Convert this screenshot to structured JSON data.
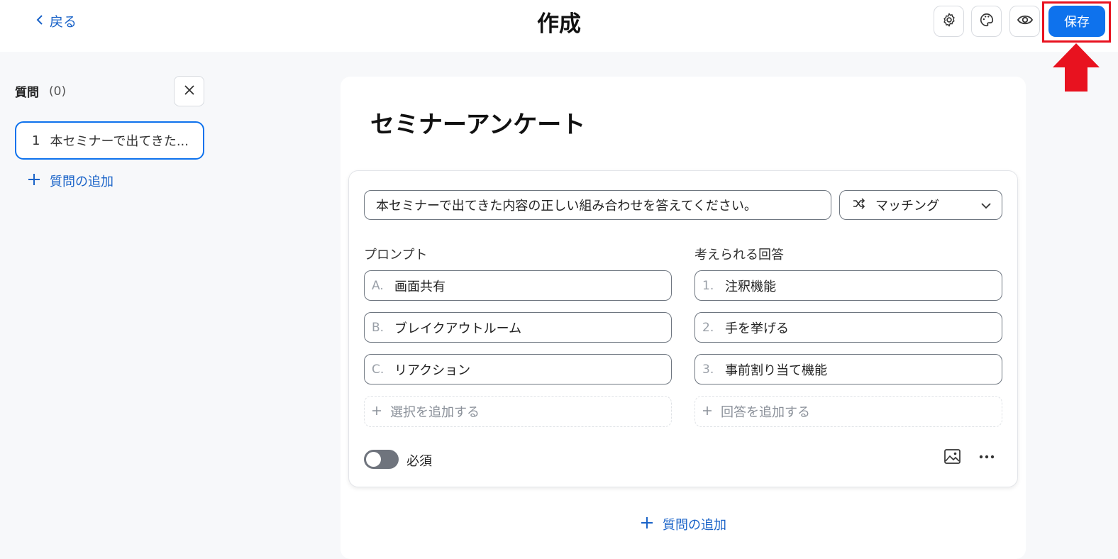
{
  "header": {
    "back_label": "戻る",
    "title": "作成",
    "icons": [
      "gear-icon",
      "palette-icon",
      "eye-icon"
    ],
    "save_label": "保存",
    "accent": "#0e72ed",
    "highlight_color": "#e8121f"
  },
  "sidebar": {
    "title": "質問",
    "count": "(0)",
    "questions": [
      {
        "number": "1",
        "text": "本セミナーで出てきた..."
      }
    ],
    "add_label": "質問の追加"
  },
  "survey": {
    "title": "セミナーアンケート",
    "question": {
      "text": "本セミナーで出てきた内容の正しい組み合わせを答えてください。",
      "type_label": "マッチング",
      "prompt_label": "プロンプト",
      "answers_label": "考えられる回答",
      "prompts": [
        {
          "prefix": "A.",
          "text": "画面共有"
        },
        {
          "prefix": "B.",
          "text": "ブレイクアウトルーム"
        },
        {
          "prefix": "C.",
          "text": "リアクション"
        }
      ],
      "answers": [
        {
          "prefix": "1.",
          "text": "注釈機能"
        },
        {
          "prefix": "2.",
          "text": "手を挙げる"
        },
        {
          "prefix": "3.",
          "text": "事前割り当て機能"
        }
      ],
      "add_prompt_label": "選択を追加する",
      "add_answer_label": "回答を追加する",
      "required_label": "必須",
      "required_on": false
    },
    "add_question_label": "質問の追加"
  }
}
